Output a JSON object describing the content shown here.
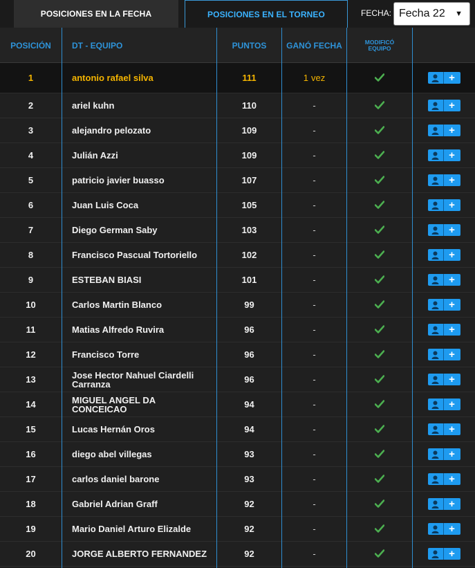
{
  "tabs": [
    {
      "label": "POSICIONES EN LA FECHA",
      "active": false
    },
    {
      "label": "POSICIONES EN EL TORNEO",
      "active": true
    }
  ],
  "fecha": {
    "label": "FECHA:",
    "selected": "Fecha 22"
  },
  "columns": {
    "position": "POSICIÓN",
    "team": "DT - EQUIPO",
    "points": "PUNTOS",
    "won": "GANÓ FECHA",
    "modified_line1": "MODIFICÓ",
    "modified_line2": "EQUIPO"
  },
  "colors": {
    "accent": "#2e93d9",
    "leader": "#f4b400",
    "check": "#4caf50",
    "button": "#1e9bf0"
  },
  "rows": [
    {
      "pos": "1",
      "name": "antonio rafael silva",
      "points": "111",
      "won_count": "1",
      "won_unit": "vez"
    },
    {
      "pos": "2",
      "name": "ariel kuhn",
      "points": "110",
      "won": "-"
    },
    {
      "pos": "3",
      "name": "alejandro pelozato",
      "points": "109",
      "won": "-"
    },
    {
      "pos": "4",
      "name": "Julián Azzi",
      "points": "109",
      "won": "-"
    },
    {
      "pos": "5",
      "name": "patricio javier buasso",
      "points": "107",
      "won": "-"
    },
    {
      "pos": "6",
      "name": "Juan Luis Coca",
      "points": "105",
      "won": "-"
    },
    {
      "pos": "7",
      "name": "Diego German Saby",
      "points": "103",
      "won": "-"
    },
    {
      "pos": "8",
      "name": "Francisco Pascual Tortoriello",
      "points": "102",
      "won": "-"
    },
    {
      "pos": "9",
      "name": "ESTEBAN BIASI",
      "points": "101",
      "won": "-"
    },
    {
      "pos": "10",
      "name": "Carlos Martin Blanco",
      "points": "99",
      "won": "-"
    },
    {
      "pos": "11",
      "name": "Matias Alfredo Ruvira",
      "points": "96",
      "won": "-"
    },
    {
      "pos": "12",
      "name": "Francisco Torre",
      "points": "96",
      "won": "-"
    },
    {
      "pos": "13",
      "name": "Jose Hector Nahuel Ciardelli Carranza",
      "points": "96",
      "won": "-"
    },
    {
      "pos": "14",
      "name": "MIGUEL ANGEL DA CONCEICAO",
      "points": "94",
      "won": "-"
    },
    {
      "pos": "15",
      "name": "Lucas Hernán Oros",
      "points": "94",
      "won": "-"
    },
    {
      "pos": "16",
      "name": "diego abel villegas",
      "points": "93",
      "won": "-"
    },
    {
      "pos": "17",
      "name": "carlos daniel barone",
      "points": "93",
      "won": "-"
    },
    {
      "pos": "18",
      "name": "Gabriel Adrian Graff",
      "points": "92",
      "won": "-"
    },
    {
      "pos": "19",
      "name": "Mario Daniel Arturo Elizalde",
      "points": "92",
      "won": "-"
    },
    {
      "pos": "20",
      "name": "JORGE ALBERTO FERNANDEZ",
      "points": "92",
      "won": "-"
    }
  ],
  "icons": {
    "modified": "check-icon",
    "follow": "user-icon",
    "add": "plus-icon",
    "dropdown": "caret-down-icon"
  }
}
